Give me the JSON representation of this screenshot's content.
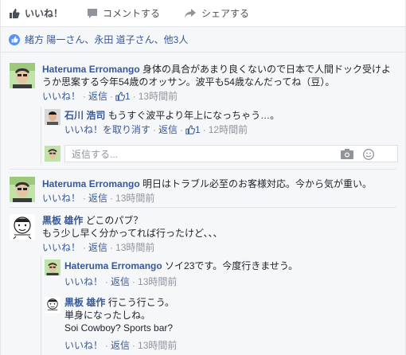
{
  "actions": {
    "like": "いいね！",
    "comment": "コメントする",
    "share": "シェアする"
  },
  "likes_summary": "緒方 陽一さん、永田 道子さん、他3人",
  "comments": [
    {
      "author": "Hateruma Erromango",
      "text": "身体の具合があまり良くないので日本で人間ドック受けようか思案する今年54歳のオッサン。波平も54歳なんだってね（豆）。",
      "like": "いいね！",
      "reply": "返信",
      "like_count": "1",
      "time": "13時間前",
      "replies": [
        {
          "author": "石川 浩司",
          "text": "もうすぐ波平より年上になっちゃう…。",
          "like": "いいね！を取り消す",
          "reply": "返信",
          "like_count": "1",
          "time": "12時間前"
        }
      ],
      "reply_placeholder": "返信する..."
    },
    {
      "author": "Hateruma Erromango",
      "text": "明日はトラブル必至のお客様対応。今から気が重い。",
      "like": "いいね！",
      "reply": "返信",
      "time": "13時間前"
    },
    {
      "author": "黒板 雄作",
      "line1": "どこのパブ？",
      "line2": "もう少し早く分かってれば行ったけど、、、",
      "like": "いいね！",
      "reply": "返信",
      "time": "13時間前",
      "replies": [
        {
          "author": "Hateruma Erromango",
          "text": "ソイ23です。今度行きませう。",
          "like": "いいね！",
          "reply": "返信",
          "time": "13時間前"
        },
        {
          "author": "黒板 雄作",
          "line1": "行こう行こう。",
          "line2": "単身になったしね。",
          "line3": "Soi Cowboy? Sports bar?",
          "like": "いいね！",
          "reply": "返信",
          "time": "13時間前"
        }
      ]
    }
  ],
  "colors": {
    "link": "#365899",
    "meta": "#90949c",
    "bg": "#f6f7f9",
    "like_blue": "#5890ff"
  }
}
